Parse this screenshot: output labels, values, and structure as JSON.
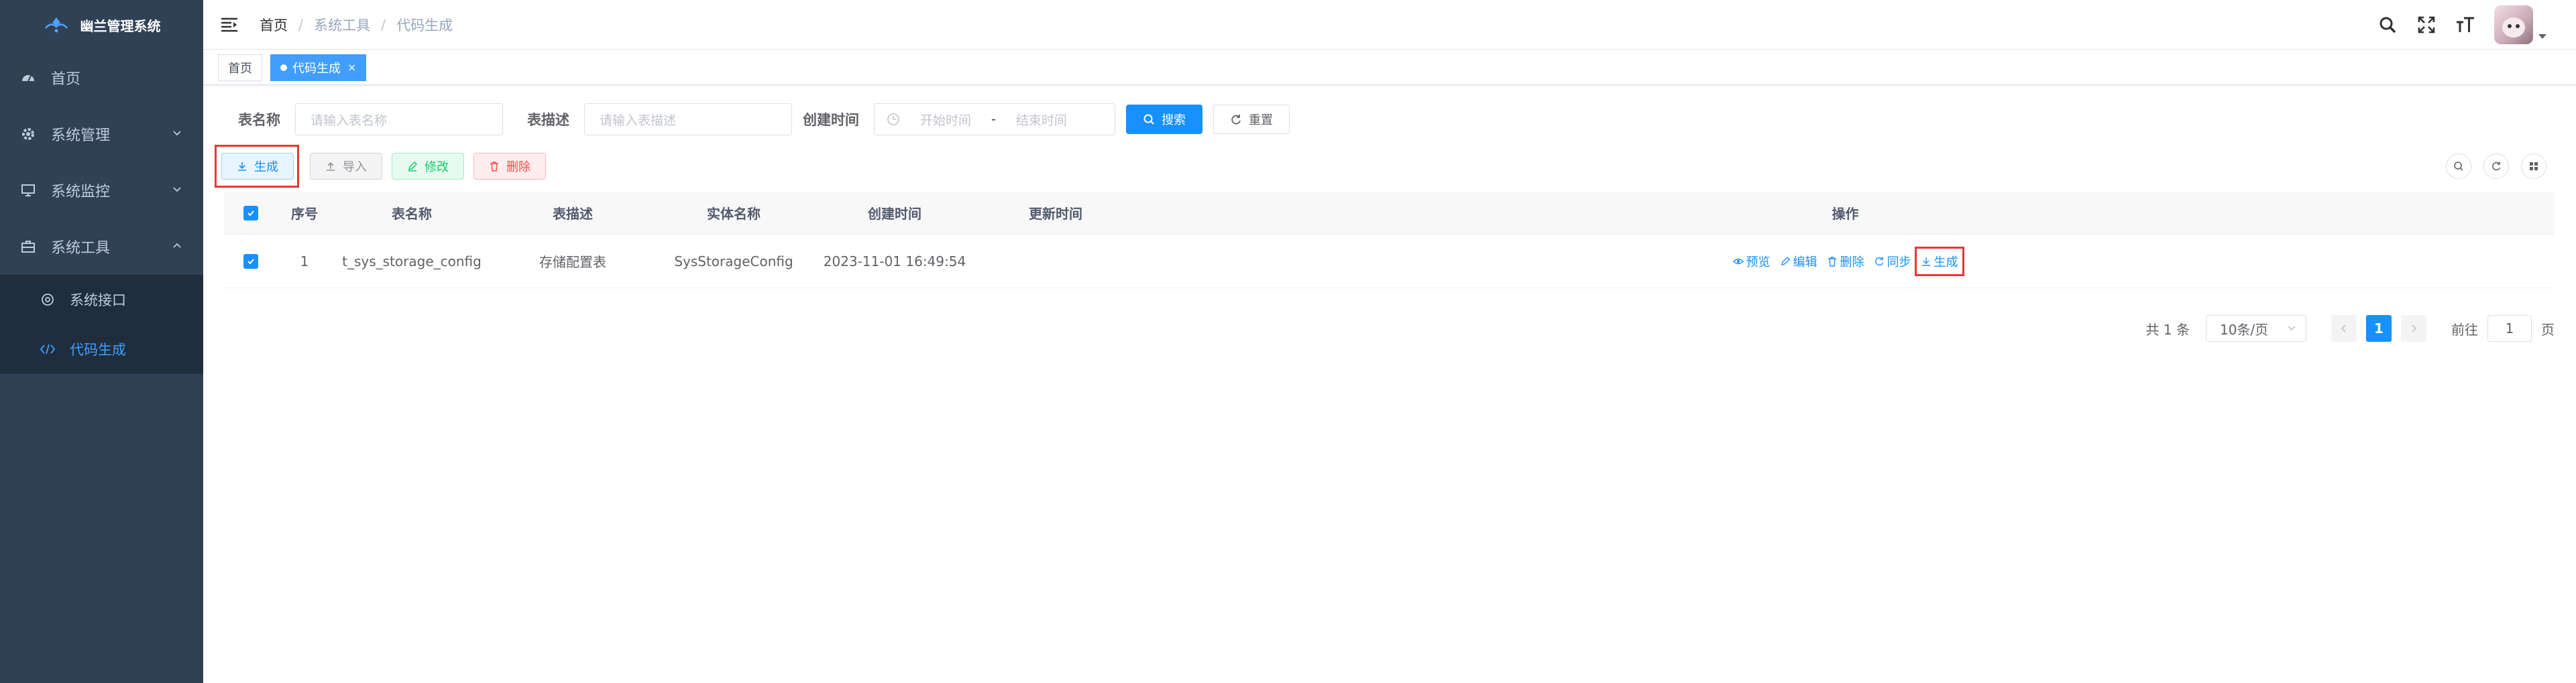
{
  "sidebar": {
    "title": "幽兰管理系统",
    "items": [
      {
        "label": "首页",
        "icon": "dashboard-icon"
      },
      {
        "label": "系统管理",
        "icon": "gear-icon"
      },
      {
        "label": "系统监控",
        "icon": "monitor-icon"
      },
      {
        "label": "系统工具",
        "icon": "toolbox-icon"
      }
    ],
    "subitems": [
      {
        "label": "系统接口",
        "icon": "api-icon"
      },
      {
        "label": "代码生成",
        "icon": "code-icon"
      }
    ]
  },
  "breadcrumb": [
    "首页",
    "系统工具",
    "代码生成"
  ],
  "tags": [
    {
      "label": "首页"
    },
    {
      "label": "代码生成"
    }
  ],
  "search": {
    "table_name_label": "表名称",
    "table_name_placeholder": "请输入表名称",
    "table_desc_label": "表描述",
    "table_desc_placeholder": "请输入表描述",
    "created_label": "创建时间",
    "start_placeholder": "开始时间",
    "end_placeholder": "结束时间",
    "range_sep": "-",
    "search_btn": "搜索",
    "reset_btn": "重置"
  },
  "toolbar": {
    "generate": "生成",
    "import": "导入",
    "modify": "修改",
    "delete": "删除"
  },
  "table": {
    "columns": [
      "序号",
      "表名称",
      "表描述",
      "实体名称",
      "创建时间",
      "更新时间",
      "操作"
    ],
    "rows": [
      {
        "index": "1",
        "table_name": "t_sys_storage_config",
        "desc": "存储配置表",
        "entity": "SysStorageConfig",
        "created": "2023-11-01 16:49:54",
        "updated": ""
      }
    ],
    "ops": [
      "预览",
      "编辑",
      "删除",
      "同步",
      "生成"
    ]
  },
  "pagination": {
    "total": "共 1 条",
    "page_size": "10条/页",
    "current": "1",
    "goto_label": "前往",
    "goto_value": "1",
    "page_unit": "页"
  },
  "colors": {
    "sidebar_bg": "#304156",
    "primary": "#1890ff",
    "highlight_box": "#e53935"
  }
}
